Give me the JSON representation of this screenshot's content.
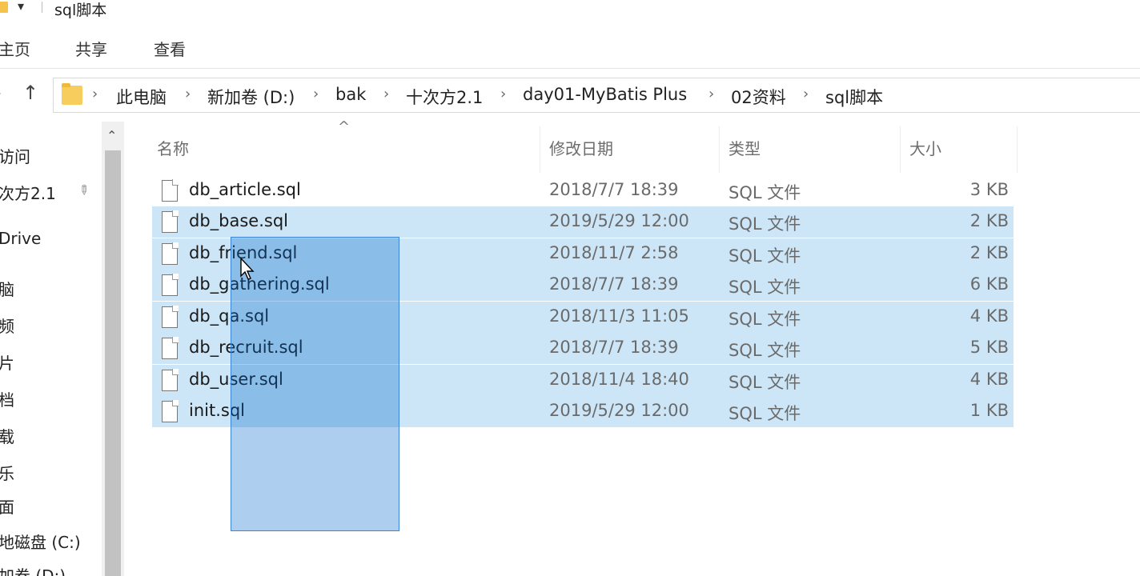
{
  "window": {
    "title": "sql脚本",
    "quick_access_glyph": "▾"
  },
  "ribbon": {
    "tabs": [
      "主页",
      "共享",
      "查看"
    ]
  },
  "address_bar": {
    "crumbs": [
      "此电脑",
      "新加卷 (D:)",
      "bak",
      "十次方2.1",
      "day01-MyBatis Plus",
      "02资料",
      "sql脚本"
    ],
    "separator": "›",
    "back_glyph": "›",
    "up_glyph": "↑"
  },
  "nav_pane": {
    "items": [
      "访问",
      "次方2.1",
      "Drive",
      "脑",
      "频",
      "片",
      "档",
      "载",
      "乐",
      "面",
      "地磁盘 (C:)",
      "加卷 (D:)"
    ]
  },
  "columns": {
    "name": "名称",
    "date": "修改日期",
    "type": "类型",
    "size": "大小",
    "sort_glyph": "^"
  },
  "files": [
    {
      "name": "db_article.sql",
      "date": "2018/7/7 18:39",
      "type": "SQL 文件",
      "size": "3 KB",
      "selected": false
    },
    {
      "name": "db_base.sql",
      "date": "2019/5/29 12:00",
      "type": "SQL 文件",
      "size": "2 KB",
      "selected": true
    },
    {
      "name": "db_friend.sql",
      "date": "2018/11/7 2:58",
      "type": "SQL 文件",
      "size": "2 KB",
      "selected": true
    },
    {
      "name": "db_gathering.sql",
      "date": "2018/7/7 18:39",
      "type": "SQL 文件",
      "size": "6 KB",
      "selected": true
    },
    {
      "name": "db_qa.sql",
      "date": "2018/11/3 11:05",
      "type": "SQL 文件",
      "size": "4 KB",
      "selected": true
    },
    {
      "name": "db_recruit.sql",
      "date": "2018/7/7 18:39",
      "type": "SQL 文件",
      "size": "5 KB",
      "selected": true
    },
    {
      "name": "db_user.sql",
      "date": "2018/11/4 18:40",
      "type": "SQL 文件",
      "size": "4 KB",
      "selected": true
    },
    {
      "name": "init.sql",
      "date": "2019/5/29 12:00",
      "type": "SQL 文件",
      "size": "1 KB",
      "selected": true
    }
  ],
  "colors": {
    "selection": "#cde6f7",
    "marquee": "#3a86d4",
    "folder": "#f7ce5d"
  }
}
